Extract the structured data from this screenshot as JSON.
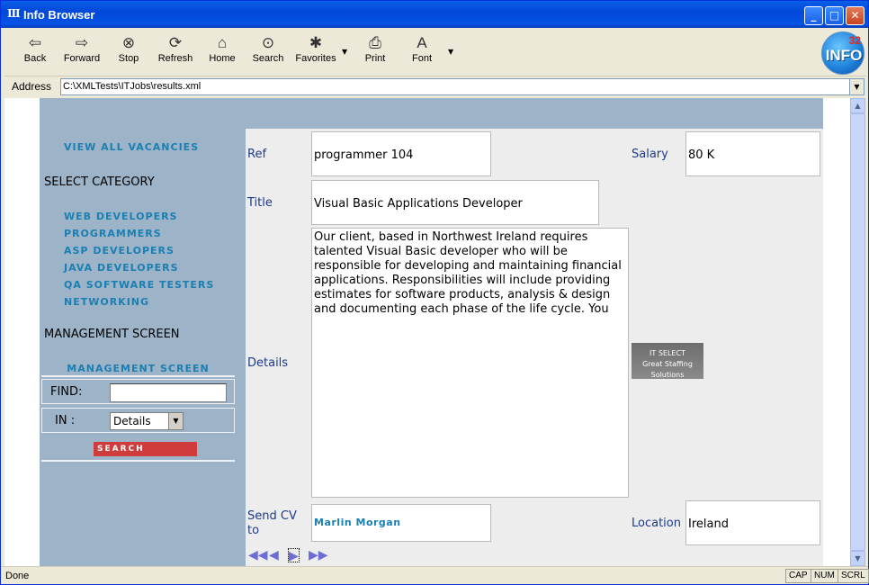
{
  "window": {
    "title": "Info Browser"
  },
  "toolbar": {
    "back": "Back",
    "forward": "Forward",
    "stop": "Stop",
    "refresh": "Refresh",
    "home": "Home",
    "search": "Search",
    "favorites": "Favorites",
    "print": "Print",
    "font": "Font"
  },
  "logo": {
    "number": "32",
    "text": "INFO"
  },
  "address": {
    "label": "Address",
    "value": "C:\\XMLTests\\ITJobs\\results.xml"
  },
  "sidebar": {
    "view_all": "VIEW ALL VACANCIES",
    "select_category": "SELECT CATEGORY",
    "categories": [
      "WEB DEVELOPERS",
      "PROGRAMMERS",
      "ASP DEVELOPERS",
      "JAVA DEVELOPERS",
      "QA SOFTWARE TESTERS",
      "NETWORKING"
    ],
    "management_heading": "MANAGEMENT SCREEN",
    "management_link": "MANAGEMENT SCREEN",
    "find_label": "FIND:",
    "in_label": "IN :",
    "in_selected": "Details",
    "search_button": "Search"
  },
  "job": {
    "ref_label": "Ref",
    "ref_value": "programmer 104",
    "salary_label": "Salary",
    "salary_value": "80 K",
    "title_label": "Title",
    "title_value": "Visual Basic Applications Developer",
    "details_label": "Details",
    "details_value": "Our client, based in Northwest Ireland requires talented Visual Basic developer who will be responsible for developing and maintaining financial applications. Responsibilities will include providing estimates for software products, analysis & design and documenting each phase of the life cycle. You",
    "send_cv_label": "Send CV to",
    "send_cv_value": "Marlin Morgan",
    "location_label": "Location",
    "location_value": "Ireland",
    "brand_text": "IT SELECT",
    "brand_sub": "Great Staffing Solutions"
  },
  "status": {
    "text": "Done",
    "cap": "CAP",
    "num": "NUM",
    "scrl": "SCRL"
  }
}
